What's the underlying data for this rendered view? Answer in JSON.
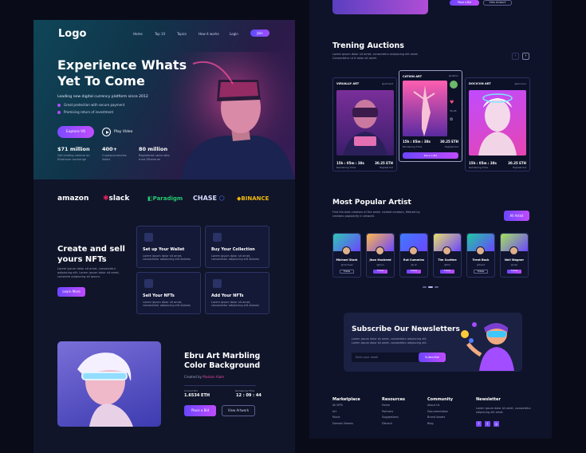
{
  "hero": {
    "logo": "Logo",
    "nav": [
      "Home",
      "Top 10",
      "Topics",
      "How it works",
      "Login"
    ],
    "join": "Join",
    "title": "Experience Whats Yet To Come",
    "subtitle": "Leading new digital currency platform since 2012",
    "bullets": [
      "Great protection with secure payment",
      "Promising return of investment"
    ],
    "explore": "Explore V6",
    "play": "Play Video",
    "stats": [
      {
        "value": "$71 million",
        "desc": "Get trading volume on Ethereum exchange"
      },
      {
        "value": "400+",
        "desc": "Cryptocurrencies listed"
      },
      {
        "value": "80 million",
        "desc": "Registered users who trust Ethereum"
      }
    ]
  },
  "partners": [
    "amazon",
    "slack",
    "Paradigm",
    "CHASE",
    "BINANCE"
  ],
  "create": {
    "title": "Create and sell yours NFTs",
    "desc": "Lorem ipsum dolor sit amet, consectetur adipiscing elit. Lorem ipsum dolor sit amet, consecte adipiscing sit ipsum.",
    "learn": "Learn More",
    "cards": [
      {
        "title": "Set up Your Wallet",
        "desc": "Lorem ipsum dolor sit amet, consectetur adipiscing elit dolores"
      },
      {
        "title": "Buy Your Collection",
        "desc": "Lorem ipsum dolor sit amet, consectetur adipiscing elit dolores"
      },
      {
        "title": "Sell Your NFTs",
        "desc": "Lorem ipsum dolor sit amet, consectetur adipiscing elit dolores"
      },
      {
        "title": "Add Your NFTs",
        "desc": "Lorem ipsum dolor sit amet, consectetur adipiscing elit dolores"
      }
    ]
  },
  "featured": {
    "title": "Ebru Art Marbling Color Background",
    "by_label": "Created by",
    "by_name": "Muskan Alam",
    "bid_label": "Current Bid",
    "bid_value": "1.6534 ETH",
    "time_label": "Remaining Time",
    "time_value": "12 : 09 : 44",
    "place_bid": "Place a Bid",
    "view": "View Artwork"
  },
  "top_buttons": {
    "place_bid": "Place a Bid",
    "view": "View Artwork"
  },
  "auctions": {
    "title": "Trening Auctions",
    "desc": "Lorem ipsum dolor sit amet, consectetur adipiscing elit amet. Consectetur ut it dolor sit amet.",
    "items": [
      {
        "name": "VIRUALLY ART",
        "creator": "@virtuart",
        "time": "15h : 05m : 38s",
        "price": "30.25 ETH",
        "l1": "Remaining Time",
        "l2": "Highest bid"
      },
      {
        "name": "CATION ART",
        "creator": "@cation",
        "time": "15h : 05m : 38s",
        "price": "30.25 ETH",
        "l1": "Remaining Time",
        "l2": "Highest bid",
        "bid": "Place a Bid"
      },
      {
        "name": "DOCICON ART",
        "creator": "@docicon",
        "time": "15h : 05m : 38s",
        "price": "30.25 ETH",
        "l1": "Remaining Time",
        "l2": "Highest bid"
      }
    ]
  },
  "artists": {
    "title": "Most Popular Artist",
    "desc": "Find the best creators of the week, ranked creators, filtered by creators popularity in artwork.",
    "all": "All Artist",
    "items": [
      {
        "name": "Michael Stark",
        "handle": "@michael",
        "btn": "Follow",
        "active": false,
        "color": "#2ec7b3"
      },
      {
        "name": "Jhon Hasheed",
        "handle": "@jhon",
        "btn": "Follow",
        "active": true,
        "color": "#ffb84a"
      },
      {
        "name": "Rut Cummins",
        "handle": "@rut",
        "btn": "Follow",
        "active": true,
        "color": "#3e7bff"
      },
      {
        "name": "Tim Scottee",
        "handle": "@tim",
        "btn": "Follow",
        "active": true,
        "color": "#e9e06a"
      },
      {
        "name": "Trent Bock",
        "handle": "@trent",
        "btn": "Follow",
        "active": false,
        "color": "#1ec9a0"
      },
      {
        "name": "Neil Wagner",
        "handle": "@neil",
        "btn": "Follow",
        "active": true,
        "color": "#a4e35a"
      }
    ]
  },
  "newsletter": {
    "title": "Subscribe Our Newsletters",
    "desc": "Lorem ipsum dolor sit amet, consectetur adipiscing elit. Lorem ipsum dolor sit amet, consectetur adipiscing elit.",
    "placeholder": "Enter your email",
    "btn": "Subscribe"
  },
  "footer": {
    "marketplace": {
      "title": "Marketplace",
      "items": [
        "All NFTs",
        "Art",
        "Music",
        "Domain Names"
      ]
    },
    "resources": {
      "title": "Resources",
      "items": [
        "Home",
        "Partners",
        "Suggestions",
        "Discord"
      ]
    },
    "community": {
      "title": "Community",
      "items": [
        "About Us",
        "Documentation",
        "Brand Assets",
        "Blog"
      ]
    },
    "newsletter": {
      "title": "Newsletter",
      "desc": "Lorem ipsum dolor sit amet, consectetur adipiscing elit amet."
    }
  },
  "colors": {
    "accent": "#a24dff",
    "accent2": "#5b4bff",
    "bg": "#10152a"
  }
}
